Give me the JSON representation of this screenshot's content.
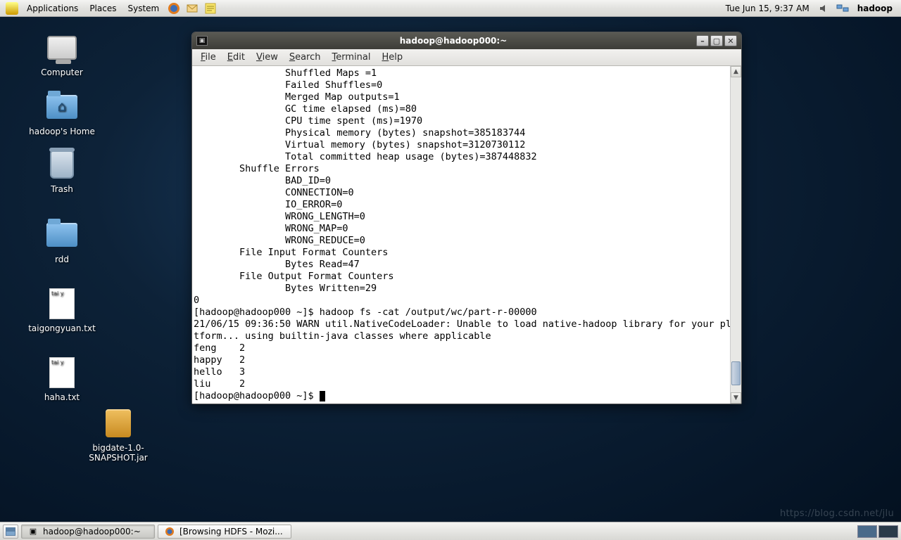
{
  "panel": {
    "apps": "Applications",
    "places": "Places",
    "system": "System",
    "clock": "Tue Jun 15,  9:37 AM",
    "user": "hadoop"
  },
  "desktop": {
    "computer": "Computer",
    "home": "hadoop's Home",
    "trash": "Trash",
    "rdd": "rdd",
    "taigong": "taigongyuan.txt",
    "haha": "haha.txt",
    "jar": "bigdate-1.0-SNAPSHOT.jar",
    "filehint": "tai y"
  },
  "window": {
    "title": "hadoop@hadoop000:~",
    "menu": {
      "file": "File",
      "edit": "Edit",
      "view": "View",
      "search": "Search",
      "terminal": "Terminal",
      "help": "Help"
    }
  },
  "terminal": {
    "lines": "                Shuffled Maps =1\n                Failed Shuffles=0\n                Merged Map outputs=1\n                GC time elapsed (ms)=80\n                CPU time spent (ms)=1970\n                Physical memory (bytes) snapshot=385183744\n                Virtual memory (bytes) snapshot=3120730112\n                Total committed heap usage (bytes)=387448832\n        Shuffle Errors\n                BAD_ID=0\n                CONNECTION=0\n                IO_ERROR=0\n                WRONG_LENGTH=0\n                WRONG_MAP=0\n                WRONG_REDUCE=0\n        File Input Format Counters\n                Bytes Read=47\n        File Output Format Counters\n                Bytes Written=29\n0\n[hadoop@hadoop000 ~]$ hadoop fs -cat /output/wc/part-r-00000\n21/06/15 09:36:50 WARN util.NativeCodeLoader: Unable to load native-hadoop library for your pla\ntform... using builtin-java classes where applicable\nfeng    2\nhappy   2\nhello   3\nliu     2",
    "prompt": "[hadoop@hadoop000 ~]$ "
  },
  "taskbar": {
    "t1": "hadoop@hadoop000:~",
    "t2": "[Browsing HDFS - Mozi..."
  },
  "watermark": "https://blog.csdn.net/jlu"
}
